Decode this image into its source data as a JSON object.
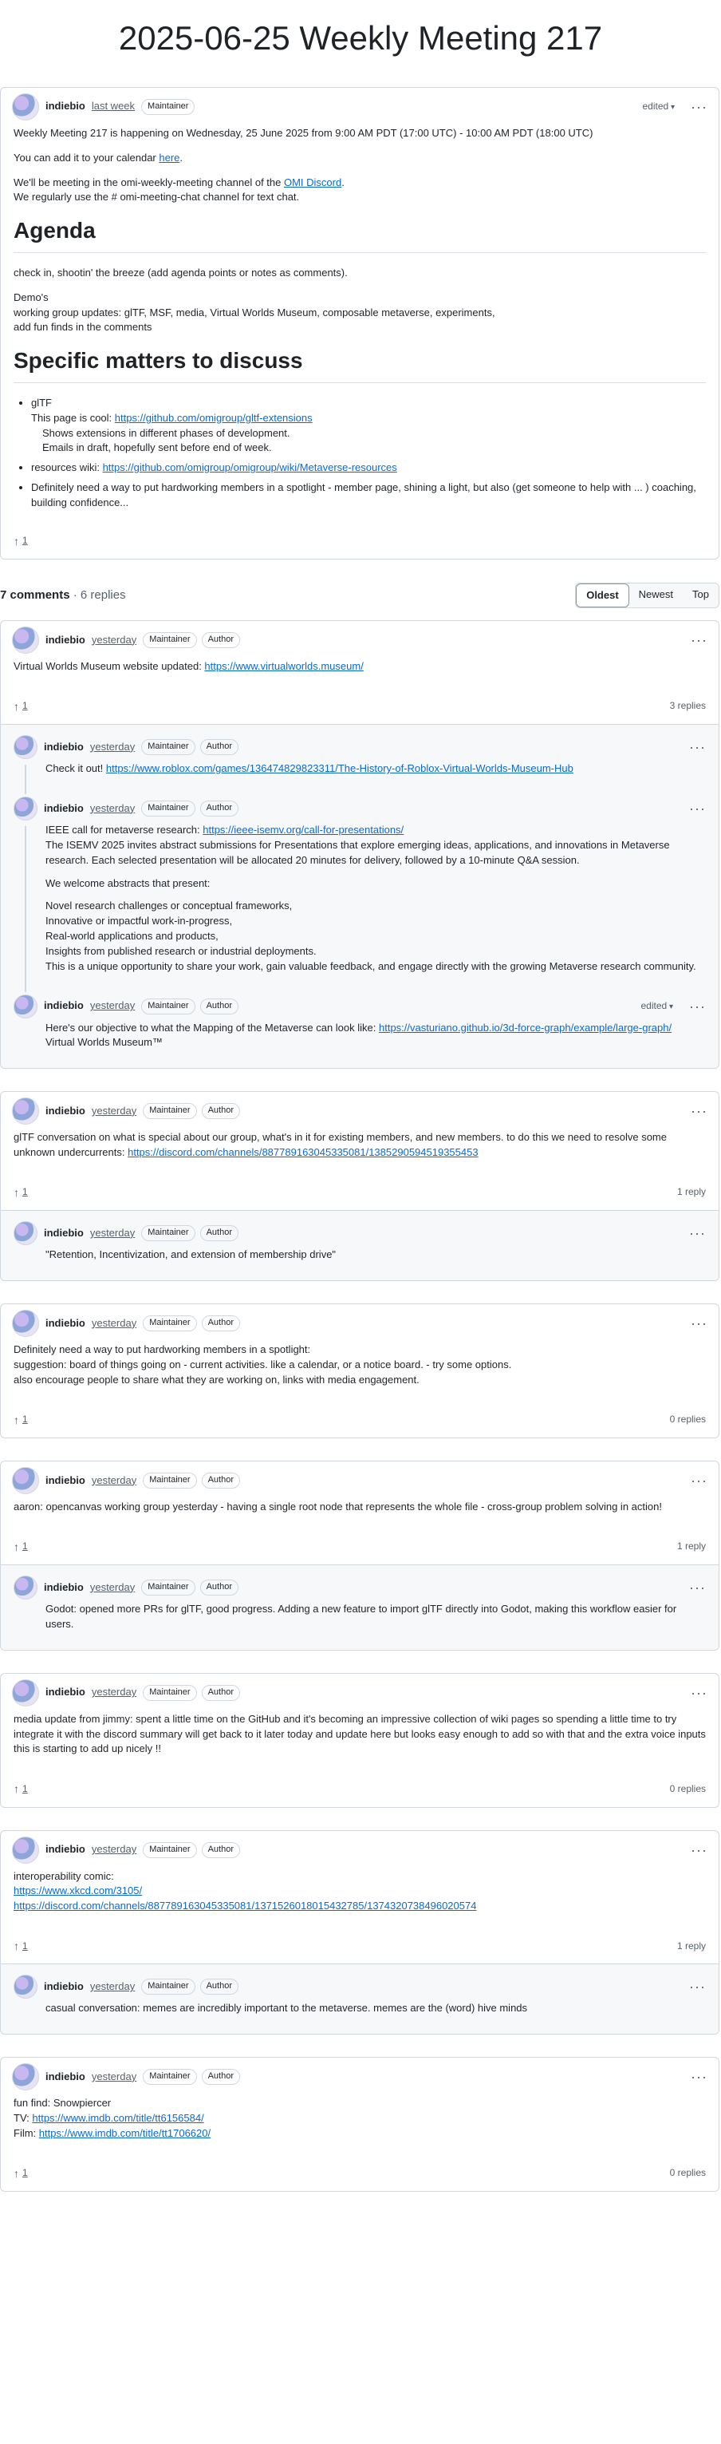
{
  "page_title": "2025-06-25 Weekly Meeting 217",
  "badges": {
    "maintainer": "Maintainer",
    "author": "Author"
  },
  "main": {
    "author": "indiebio",
    "time": "last week",
    "edited": "edited",
    "intro": "Weekly Meeting 217 is happening on Wednesday, 25 June 2025 from 9:00 AM PDT (17:00 UTC) - 10:00 AM PDT (18:00 UTC)",
    "calendar_prefix": "You can add it to your calendar ",
    "calendar_link": "here",
    "calendar_suffix": ".",
    "discord_prefix": "We'll be meeting in the omi-weekly-meeting channel of the ",
    "discord_link": "OMI Discord",
    "discord_suffix": ".",
    "chat_line": "We regularly use the # omi-meeting-chat channel for text chat.",
    "agenda_heading": "Agenda",
    "agenda_1": "check in, shootin' the breeze (add agenda points or notes as comments).",
    "demos": "Demo's",
    "wg_updates": "working group updates: glTF, MSF, media, Virtual Worlds Museum, composable metaverse, experiments,",
    "fun_finds": "add fun finds in the comments",
    "specific_heading": "Specific matters to discuss",
    "gltf_item": "glTF",
    "gltf_cool_prefix": "This page is cool: ",
    "gltf_cool_link": "https://github.com/omigroup/gltf-extensions",
    "gltf_shows": "Shows extensions in different phases of development.",
    "gltf_emails": "Emails in draft, hopefully sent before end of week.",
    "wiki_prefix": "resources wiki: ",
    "wiki_link": "https://github.com/omigroup/omigroup/wiki/Metaverse-resources",
    "spotlight": "Definitely need a way to put hardworking members in a spotlight - member page, shining a light, but also (get someone to help with ... ) coaching, building confidence...",
    "upvotes": "1"
  },
  "comments_header": {
    "count": "7 comments",
    "replies": " · 6 replies"
  },
  "sort": {
    "oldest": "Oldest",
    "newest": "Newest",
    "top": "Top"
  },
  "c1": {
    "author": "indiebio",
    "time": "yesterday",
    "text_prefix": "Virtual Worlds Museum website updated: ",
    "link": "https://www.virtualworlds.museum/",
    "upvotes": "1",
    "replies_label": "3 replies",
    "r1": {
      "author": "indiebio",
      "time": "yesterday",
      "prefix": "Check it out! ",
      "link": "https://www.roblox.com/games/136474829823311/The-History-of-Roblox-Virtual-Worlds-Museum-Hub"
    },
    "r2": {
      "author": "indiebio",
      "time": "yesterday",
      "prefix": "IEEE call for metaverse research: ",
      "link": "https://ieee-isemv.org/call-for-presentations/",
      "p1": "The ISEMV 2025 invites abstract submissions for Presentations that explore emerging ideas, applications, and innovations in Metaverse research. Each selected presentation will be allocated 20 minutes for delivery, followed by a 10-minute Q&A session.",
      "p2": "We welcome abstracts that present:",
      "l1": "Novel research challenges or conceptual frameworks,",
      "l2": "Innovative or impactful work-in-progress,",
      "l3": "Real-world applications and products,",
      "l4": "Insights from published research or industrial deployments.",
      "l5": "This is a unique opportunity to share your work, gain valuable feedback, and engage directly with the growing Metaverse research community."
    },
    "r3": {
      "author": "indiebio",
      "time": "yesterday",
      "edited": "edited",
      "prefix": "Here's our objective to what the Mapping of the Metaverse can look like: ",
      "link": "https://vasturiano.github.io/3d-force-graph/example/large-graph/",
      "line2": "Virtual Worlds Museum™"
    }
  },
  "c2": {
    "author": "indiebio",
    "time": "yesterday",
    "text": "glTF conversation on what is special about our group, what's in it for existing members, and new members. to do this we need to resolve some unknown undercurrents: ",
    "link": "https://discord.com/channels/887789163045335081/1385290594519355453",
    "upvotes": "1",
    "replies_label": "1 reply",
    "r1": {
      "author": "indiebio",
      "time": "yesterday",
      "text": "\"Retention, Incentivization, and extension of membership drive\""
    }
  },
  "c3": {
    "author": "indiebio",
    "time": "yesterday",
    "l1": "Definitely need a way to put hardworking members in a spotlight:",
    "l2": "suggestion: board of things going on - current activities. like a calendar, or a notice board. - try some options.",
    "l3": "also encourage people to share what they are working on, links with media engagement.",
    "upvotes": "1",
    "replies_label": "0 replies"
  },
  "c4": {
    "author": "indiebio",
    "time": "yesterday",
    "text": "aaron: opencanvas working group yesterday - having a single root node that represents the whole file - cross-group problem solving in action!",
    "upvotes": "1",
    "replies_label": "1 reply",
    "r1": {
      "author": "indiebio",
      "time": "yesterday",
      "text": "Godot: opened more PRs for glTF, good progress. Adding a new feature to import glTF directly into Godot, making this workflow easier for users."
    }
  },
  "c5": {
    "author": "indiebio",
    "time": "yesterday",
    "text": "media update from jimmy: spent a little time on the GitHub and it's becoming an impressive collection of wiki pages so spending a little time to try integrate it with the discord summary will get back to it later today and update here but looks easy enough to add so with that and the extra voice inputs this is starting to add up nicely !!",
    "upvotes": "1",
    "replies_label": "0 replies"
  },
  "c6": {
    "author": "indiebio",
    "time": "yesterday",
    "l1": "interoperability comic:",
    "link1": "https://www.xkcd.com/3105/",
    "link2": "https://discord.com/channels/887789163045335081/1371526018015432785/1374320738496020574",
    "upvotes": "1",
    "replies_label": "1 reply",
    "r1": {
      "author": "indiebio",
      "time": "yesterday",
      "text": "casual conversation: memes are incredibly important to the metaverse. memes are the (word) hive minds"
    }
  },
  "c7": {
    "author": "indiebio",
    "time": "yesterday",
    "l1": "fun find: Snowpiercer",
    "tv_prefix": "TV: ",
    "tv_link": "https://www.imdb.com/title/tt6156584/",
    "film_prefix": "Film: ",
    "film_link": "https://www.imdb.com/title/tt1706620/",
    "upvotes": "1",
    "replies_label": "0 replies"
  }
}
